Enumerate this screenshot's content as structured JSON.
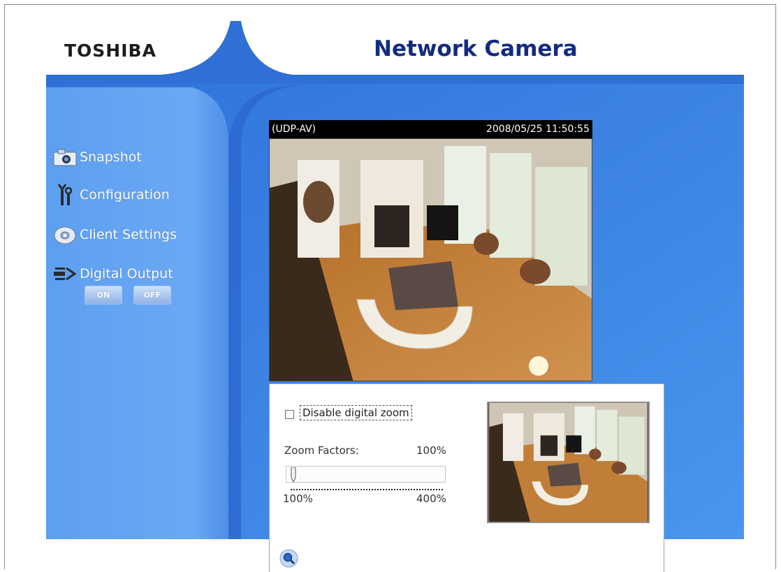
{
  "header": {
    "brand": "TOSHIBA",
    "title": "Network Camera"
  },
  "sidebar": {
    "items": [
      {
        "label": "Snapshot",
        "icon": "camera-icon"
      },
      {
        "label": "Configuration",
        "icon": "tools-icon"
      },
      {
        "label": "Client Settings",
        "icon": "disc-icon"
      },
      {
        "label": "Digital Output",
        "icon": "plug-icon"
      }
    ],
    "digital_output": {
      "on_label": "ON",
      "off_label": "OFF"
    }
  },
  "video": {
    "mode": "(UDP-AV)",
    "timestamp": "2008/05/25 11:50:55"
  },
  "zoom": {
    "disable_label": "Disable digital zoom",
    "disable_checked": false,
    "factor_label": "Zoom Factors:",
    "factor_value": "100%",
    "slider_min": "100%",
    "slider_max": "400%",
    "slider_level": 0,
    "zoom_icon": "magnifier-icon"
  },
  "colors": {
    "blue_main": "#3f86e6",
    "blue_sidebar": "#5a9cf0",
    "title_navy": "#142b80"
  }
}
